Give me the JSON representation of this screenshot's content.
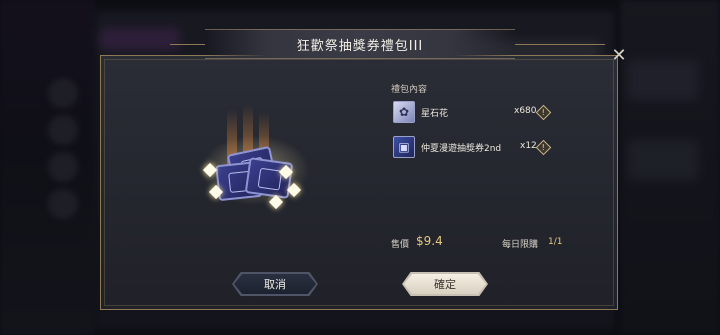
{
  "dialog": {
    "title": "狂歡祭抽獎券禮包III",
    "close_icon": "close-icon",
    "contents_label": "禮包內容",
    "items": [
      {
        "name": "星石花",
        "quantity": "x680",
        "icon": "star-stone-flower-icon"
      },
      {
        "name": "仲夏漫遊抽獎券2nd",
        "quantity": "x12",
        "icon": "lottery-ticket-icon"
      }
    ],
    "price_label": "售價",
    "price_value": "$9.4",
    "limit_label": "每日限購",
    "limit_value": "1/1",
    "cancel_label": "取消",
    "confirm_label": "確定"
  },
  "colors": {
    "accent_gold": "#e5c97f",
    "frame_gold": "#8d7a55",
    "panel": "#2b2d36"
  }
}
